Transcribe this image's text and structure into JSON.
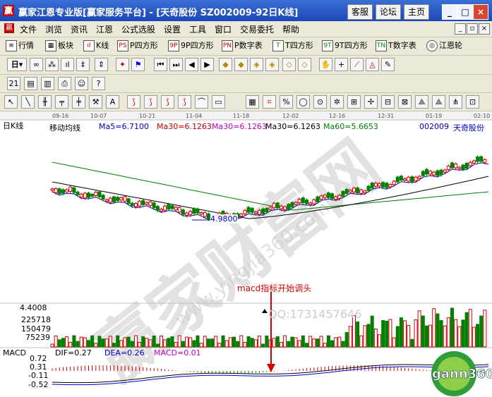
{
  "window": {
    "title": "赢家江恩专业版[赢家服务平台] - [天奇股份   SZ002009-92日K线]",
    "buttons": [
      "客服",
      "论坛",
      "主页"
    ],
    "controls": [
      "_",
      "□",
      "×"
    ]
  },
  "menu": {
    "items": [
      "文件",
      "浏览",
      "资讯",
      "江恩",
      "公式选股",
      "设置",
      "工具",
      "窗口",
      "交易委托",
      "帮助"
    ],
    "mdi": [
      "_",
      "▫",
      "×"
    ]
  },
  "toolbar1": {
    "items": [
      {
        "icon": "list-icon",
        "label": "行情"
      },
      {
        "icon": "blocks-icon",
        "label": "板块"
      },
      {
        "icon": "kline-icon",
        "label": "K线"
      },
      {
        "icon": "P",
        "label": "P四方形"
      },
      {
        "icon": "9P",
        "label": "9P四方形"
      },
      {
        "icon": "PN",
        "label": "P数字表"
      },
      {
        "icon": "T",
        "label": "T四方形"
      },
      {
        "icon": "9T",
        "label": "9T四方形"
      },
      {
        "icon": "TN",
        "label": "T数字表"
      },
      {
        "icon": "wheel-icon",
        "label": "江恩轮"
      }
    ]
  },
  "toolbar2": {
    "period": "日"
  },
  "chart": {
    "period_label": "日K线",
    "dates": [
      "09-16",
      "10-07",
      "10-21",
      "11-04",
      "11-18",
      "12-02",
      "12-16",
      "12-31",
      "01-19",
      "02-10"
    ],
    "legend_title": "移动均线",
    "ma": [
      {
        "text": "Ma5=6.7100",
        "color": "#0000c8"
      },
      {
        "text": "Ma30=6.1263",
        "color": "#c00000"
      },
      {
        "text": "Ma30=6.1263",
        "color": "#c000c0"
      },
      {
        "text": "Ma30=6.1263",
        "color": "#000000"
      },
      {
        "text": "Ma60=5.6653",
        "color": "#008000"
      }
    ],
    "stock": {
      "code": "002009",
      "name": "天奇股份"
    },
    "low_marker": "4.9800",
    "annotation": "macd指标开始调头",
    "volume_labels": [
      "4.4008",
      "225718",
      "150479",
      "75239"
    ],
    "qq_text": "QQ:1731457646",
    "watermark_cn": "赢家财富网",
    "watermark_url": "www.yingjia360.com",
    "logo_text": "gann360",
    "macd": {
      "title": "MACD",
      "dif": "DIF=0.27",
      "dea": "DEA=0.26",
      "macd": "MACD=0.01",
      "axis": [
        "0.72",
        "0.31",
        "-0.11",
        "-0.52"
      ]
    }
  },
  "chart_data": {
    "type": "candlestick",
    "ma_values": {
      "Ma5": 6.71,
      "Ma30": 6.1263,
      "Ma60": 5.6653
    },
    "low_price": 4.98,
    "volume_ticks": [
      225718,
      150479,
      75239
    ],
    "macd_ticks": [
      0.72,
      0.31,
      -0.11,
      -0.52
    ],
    "dif": 0.27,
    "dea": 0.26,
    "macd": 0.01
  }
}
